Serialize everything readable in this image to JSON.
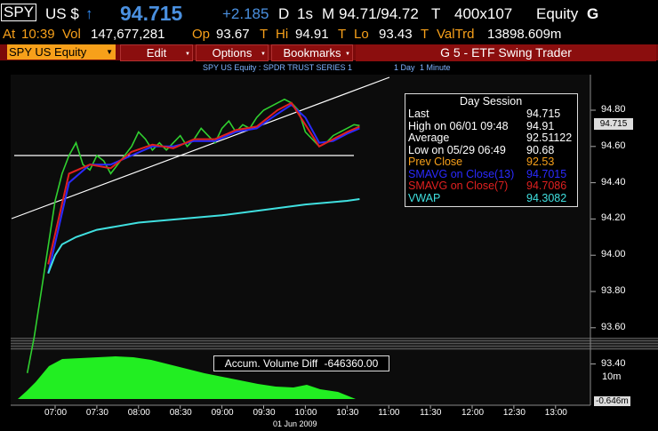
{
  "header": {
    "ticker": "SPY",
    "ticker_suffix": "US $",
    "arrow": "↑",
    "last": "94.715",
    "change": "+2.185",
    "d_label": "D",
    "interval": "1s",
    "m_label": "M",
    "bid_ask": "94.71/94.72",
    "t_label": "T",
    "size": "400x107",
    "asset_class": "Equity",
    "g_label": "G"
  },
  "quote": {
    "at_label": "At",
    "time": "10:39",
    "vol_label": "Vol",
    "volume": "147,677,281",
    "op_label": "Op",
    "open": "93.67",
    "t1": "T",
    "hi_label": "Hi",
    "high": "94.91",
    "t2": "T",
    "lo_label": "Lo",
    "low": "93.43",
    "t3": "T",
    "valtrd_label": "ValTrd",
    "valtrd": "13898.609m"
  },
  "menu": {
    "security": "SPY US Equity",
    "edit": "Edit",
    "options": "Options",
    "bookmarks": "Bookmarks",
    "title": "G 5 - ETF Swing Trader"
  },
  "subtitle": {
    "name": "SPY US Equity : SPDR TRUST SERIES 1",
    "period": "1 Day",
    "interval": "1 Minute"
  },
  "legend": {
    "title": "Day Session",
    "rows": [
      {
        "label": "Last",
        "value": "94.715",
        "color": "#ffffff"
      },
      {
        "label": "High on  06/01 09:48",
        "value": "94.91",
        "color": "#ffffff"
      },
      {
        "label": "Average",
        "value": "92.51122",
        "color": "#ffffff"
      },
      {
        "label": "Low on  05/29 06:49",
        "value": "90.68",
        "color": "#ffffff"
      },
      {
        "label": "Prev Close",
        "value": "92.53",
        "color": "#f7a01a"
      },
      {
        "label": "SMAVG on Close(13)",
        "value": "94.7015",
        "color": "#2a2aff"
      },
      {
        "label": "SMAVG on Close(7)",
        "value": "94.7086",
        "color": "#e02020"
      },
      {
        "label": "VWAP",
        "value": "94.3082",
        "color": "#40e0e0"
      }
    ]
  },
  "price_tag": "94.715",
  "volume_box": {
    "label": "Accum. Volume Diff",
    "value": "-646360.00"
  },
  "vol_axis": [
    "10m",
    "-0.646m"
  ],
  "date_label": "01 Jun 2009",
  "colors": {
    "accent": "#f7a01a",
    "menu": "#8b0e0e",
    "price": "#30d030",
    "sma13": "#2a2aff",
    "sma7": "#e02020",
    "vwap": "#40e0e0",
    "volume": "#22ee22"
  },
  "chart_data": {
    "type": "line",
    "title": "SPY US Equity : SPDR TRUST SERIES 1",
    "xlabel": "01 Jun 2009",
    "ylabel": "",
    "x_ticks": [
      "07:00",
      "07:30",
      "08:00",
      "08:30",
      "09:00",
      "09:30",
      "10:00",
      "10:30",
      "11:00",
      "11:30",
      "12:00",
      "12:30",
      "13:00"
    ],
    "y_ticks": [
      93.4,
      93.6,
      93.8,
      94.0,
      94.2,
      94.4,
      94.6,
      94.8
    ],
    "ylim": [
      93.33,
      94.92
    ],
    "grid": false,
    "series": [
      {
        "name": "Last",
        "color": "#30d030",
        "x": [
          "06:40",
          "06:45",
          "06:50",
          "06:55",
          "07:00",
          "07:05",
          "07:10",
          "07:15",
          "07:20",
          "07:25",
          "07:30",
          "07:35",
          "07:40",
          "07:45",
          "07:50",
          "07:55",
          "08:00",
          "08:05",
          "08:10",
          "08:15",
          "08:20",
          "08:25",
          "08:30",
          "08:35",
          "08:40",
          "08:45",
          "08:50",
          "08:55",
          "09:00",
          "09:05",
          "09:10",
          "09:15",
          "09:20",
          "09:25",
          "09:30",
          "09:35",
          "09:40",
          "09:45",
          "09:50",
          "09:55",
          "10:00",
          "10:05",
          "10:10",
          "10:15",
          "10:20",
          "10:25",
          "10:30",
          "10:35",
          "10:39"
        ],
        "values": [
          93.35,
          93.55,
          93.8,
          94.05,
          94.3,
          94.45,
          94.55,
          94.62,
          94.5,
          94.47,
          94.55,
          94.52,
          94.45,
          94.5,
          94.55,
          94.6,
          94.68,
          94.64,
          94.58,
          94.62,
          94.58,
          94.62,
          94.66,
          94.6,
          94.64,
          94.7,
          94.66,
          94.62,
          94.7,
          94.74,
          94.68,
          94.72,
          94.7,
          94.76,
          94.8,
          94.82,
          94.84,
          94.86,
          94.84,
          94.8,
          94.68,
          94.64,
          94.6,
          94.62,
          94.66,
          94.68,
          94.7,
          94.72,
          94.715
        ]
      },
      {
        "name": "SMAVG on Close(13)",
        "color": "#2a2aff",
        "x": [
          "06:55",
          "07:10",
          "07:25",
          "07:40",
          "07:55",
          "08:10",
          "08:25",
          "08:40",
          "08:55",
          "09:10",
          "09:25",
          "09:40",
          "09:50",
          "10:00",
          "10:10",
          "10:20",
          "10:30",
          "10:39"
        ],
        "values": [
          93.9,
          94.4,
          94.5,
          94.5,
          94.55,
          94.6,
          94.6,
          94.63,
          94.63,
          94.68,
          94.7,
          94.78,
          94.83,
          94.76,
          94.62,
          94.63,
          94.67,
          94.7
        ]
      },
      {
        "name": "SMAVG on Close(7)",
        "color": "#e02020",
        "x": [
          "06:55",
          "07:10",
          "07:25",
          "07:40",
          "07:55",
          "08:10",
          "08:25",
          "08:40",
          "08:55",
          "09:10",
          "09:25",
          "09:40",
          "09:50",
          "10:00",
          "10:10",
          "10:20",
          "10:30",
          "10:39"
        ],
        "values": [
          93.95,
          94.45,
          94.5,
          94.48,
          94.57,
          94.61,
          94.59,
          94.64,
          94.64,
          94.69,
          94.71,
          94.8,
          94.84,
          94.72,
          94.6,
          94.64,
          94.68,
          94.71
        ]
      },
      {
        "name": "VWAP",
        "color": "#40e0e0",
        "x": [
          "06:55",
          "07:00",
          "07:05",
          "07:15",
          "07:30",
          "08:00",
          "08:30",
          "09:00",
          "09:30",
          "10:00",
          "10:30",
          "10:39"
        ],
        "values": [
          93.9,
          94.0,
          94.06,
          94.1,
          94.14,
          94.18,
          94.2,
          94.22,
          94.25,
          94.28,
          94.3,
          94.31
        ]
      }
    ]
  }
}
